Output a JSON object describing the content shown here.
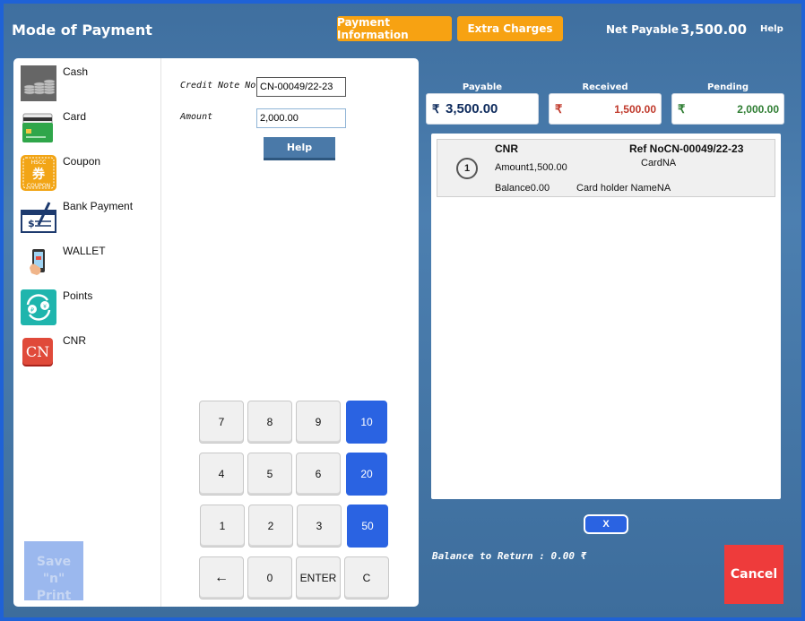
{
  "header": {
    "title": "Mode of Payment",
    "payment_info_label": "Payment Information",
    "extra_charges_label": "Extra Charges",
    "net_payable_label": "Net Payable",
    "net_payable_value": "3,500.00",
    "help_label": "Help"
  },
  "modes": [
    {
      "label": "Cash",
      "icon": "cash-icon"
    },
    {
      "label": "Card",
      "icon": "card-icon"
    },
    {
      "label": "Coupon",
      "icon": "coupon-icon"
    },
    {
      "label": "Bank Payment",
      "icon": "bank-payment-icon"
    },
    {
      "label": "WALLET",
      "icon": "wallet-icon"
    },
    {
      "label": "Points",
      "icon": "points-icon"
    },
    {
      "label": "CNR",
      "icon": "cnr-icon"
    }
  ],
  "coupon_icon_text": {
    "top": "HSCC",
    "mid": "券",
    "bottom": "COUPON"
  },
  "cnr_icon_text": "CN",
  "save_print_label": "Save \"n\" Print",
  "form": {
    "credit_note_label": "Credit Note No",
    "credit_note_value": "CN-00049/22-23",
    "amount_label": "Amount",
    "amount_value": "2,000.00",
    "help_label": "Help"
  },
  "keypad": {
    "row1": [
      "7",
      "8",
      "9",
      "10"
    ],
    "row2": [
      "4",
      "5",
      "6",
      "20"
    ],
    "row3": [
      "1",
      "2",
      "3",
      "50"
    ],
    "row4": [
      "←",
      "0",
      "ENTER",
      "C"
    ]
  },
  "summary": {
    "currency": "₹",
    "payable_label": "Payable",
    "payable_value": "3,500.00",
    "received_label": "Received",
    "received_value": "1,500.00",
    "pending_label": "Pending",
    "pending_value": "2,000.00"
  },
  "entries": [
    {
      "index": "1",
      "mode": "CNR",
      "ref": "Ref NoCN-00049/22-23",
      "amount": "Amount1,500.00",
      "card": "CardNA",
      "balance": "Balance0.00",
      "card_holder": "Card holder NameNA"
    }
  ],
  "x_label": "X",
  "balance_to_return": "Balance to Return : 0.00  ₹",
  "cancel_label": "Cancel",
  "colors": {
    "accent_orange": "#f7a212",
    "key_blue": "#2a63e2",
    "cancel_red": "#ee3b3b",
    "received_red": "#c0392b",
    "pending_green": "#2e7d32",
    "payable_navy": "#0d2a5c"
  }
}
